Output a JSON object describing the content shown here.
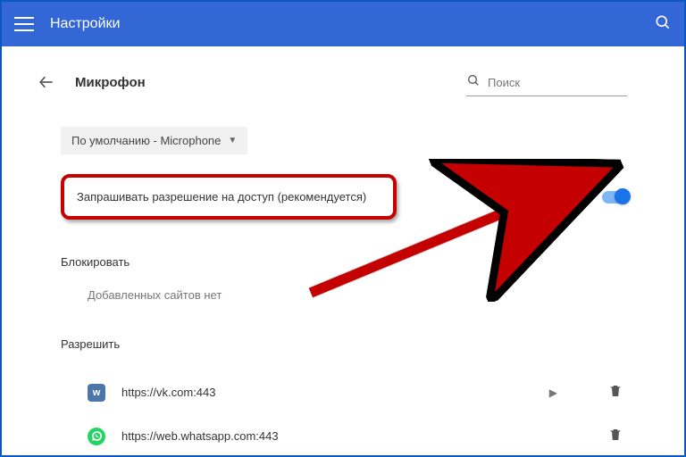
{
  "header": {
    "title": "Настройки"
  },
  "page": {
    "title": "Микрофон",
    "search_placeholder": "Поиск",
    "dropdown_label": "По умолчанию - Microphone",
    "permission_label": "Запрашивать разрешение на доступ (рекомендуется)",
    "block_label": "Блокировать",
    "block_empty": "Добавленных сайтов нет",
    "allow_label": "Разрешить",
    "allow_sites": [
      {
        "icon": "vk",
        "glyph": "w",
        "url": "https://vk.com:443"
      },
      {
        "icon": "wa",
        "glyph": "✆",
        "url": "https://web.whatsapp.com:443"
      }
    ]
  }
}
